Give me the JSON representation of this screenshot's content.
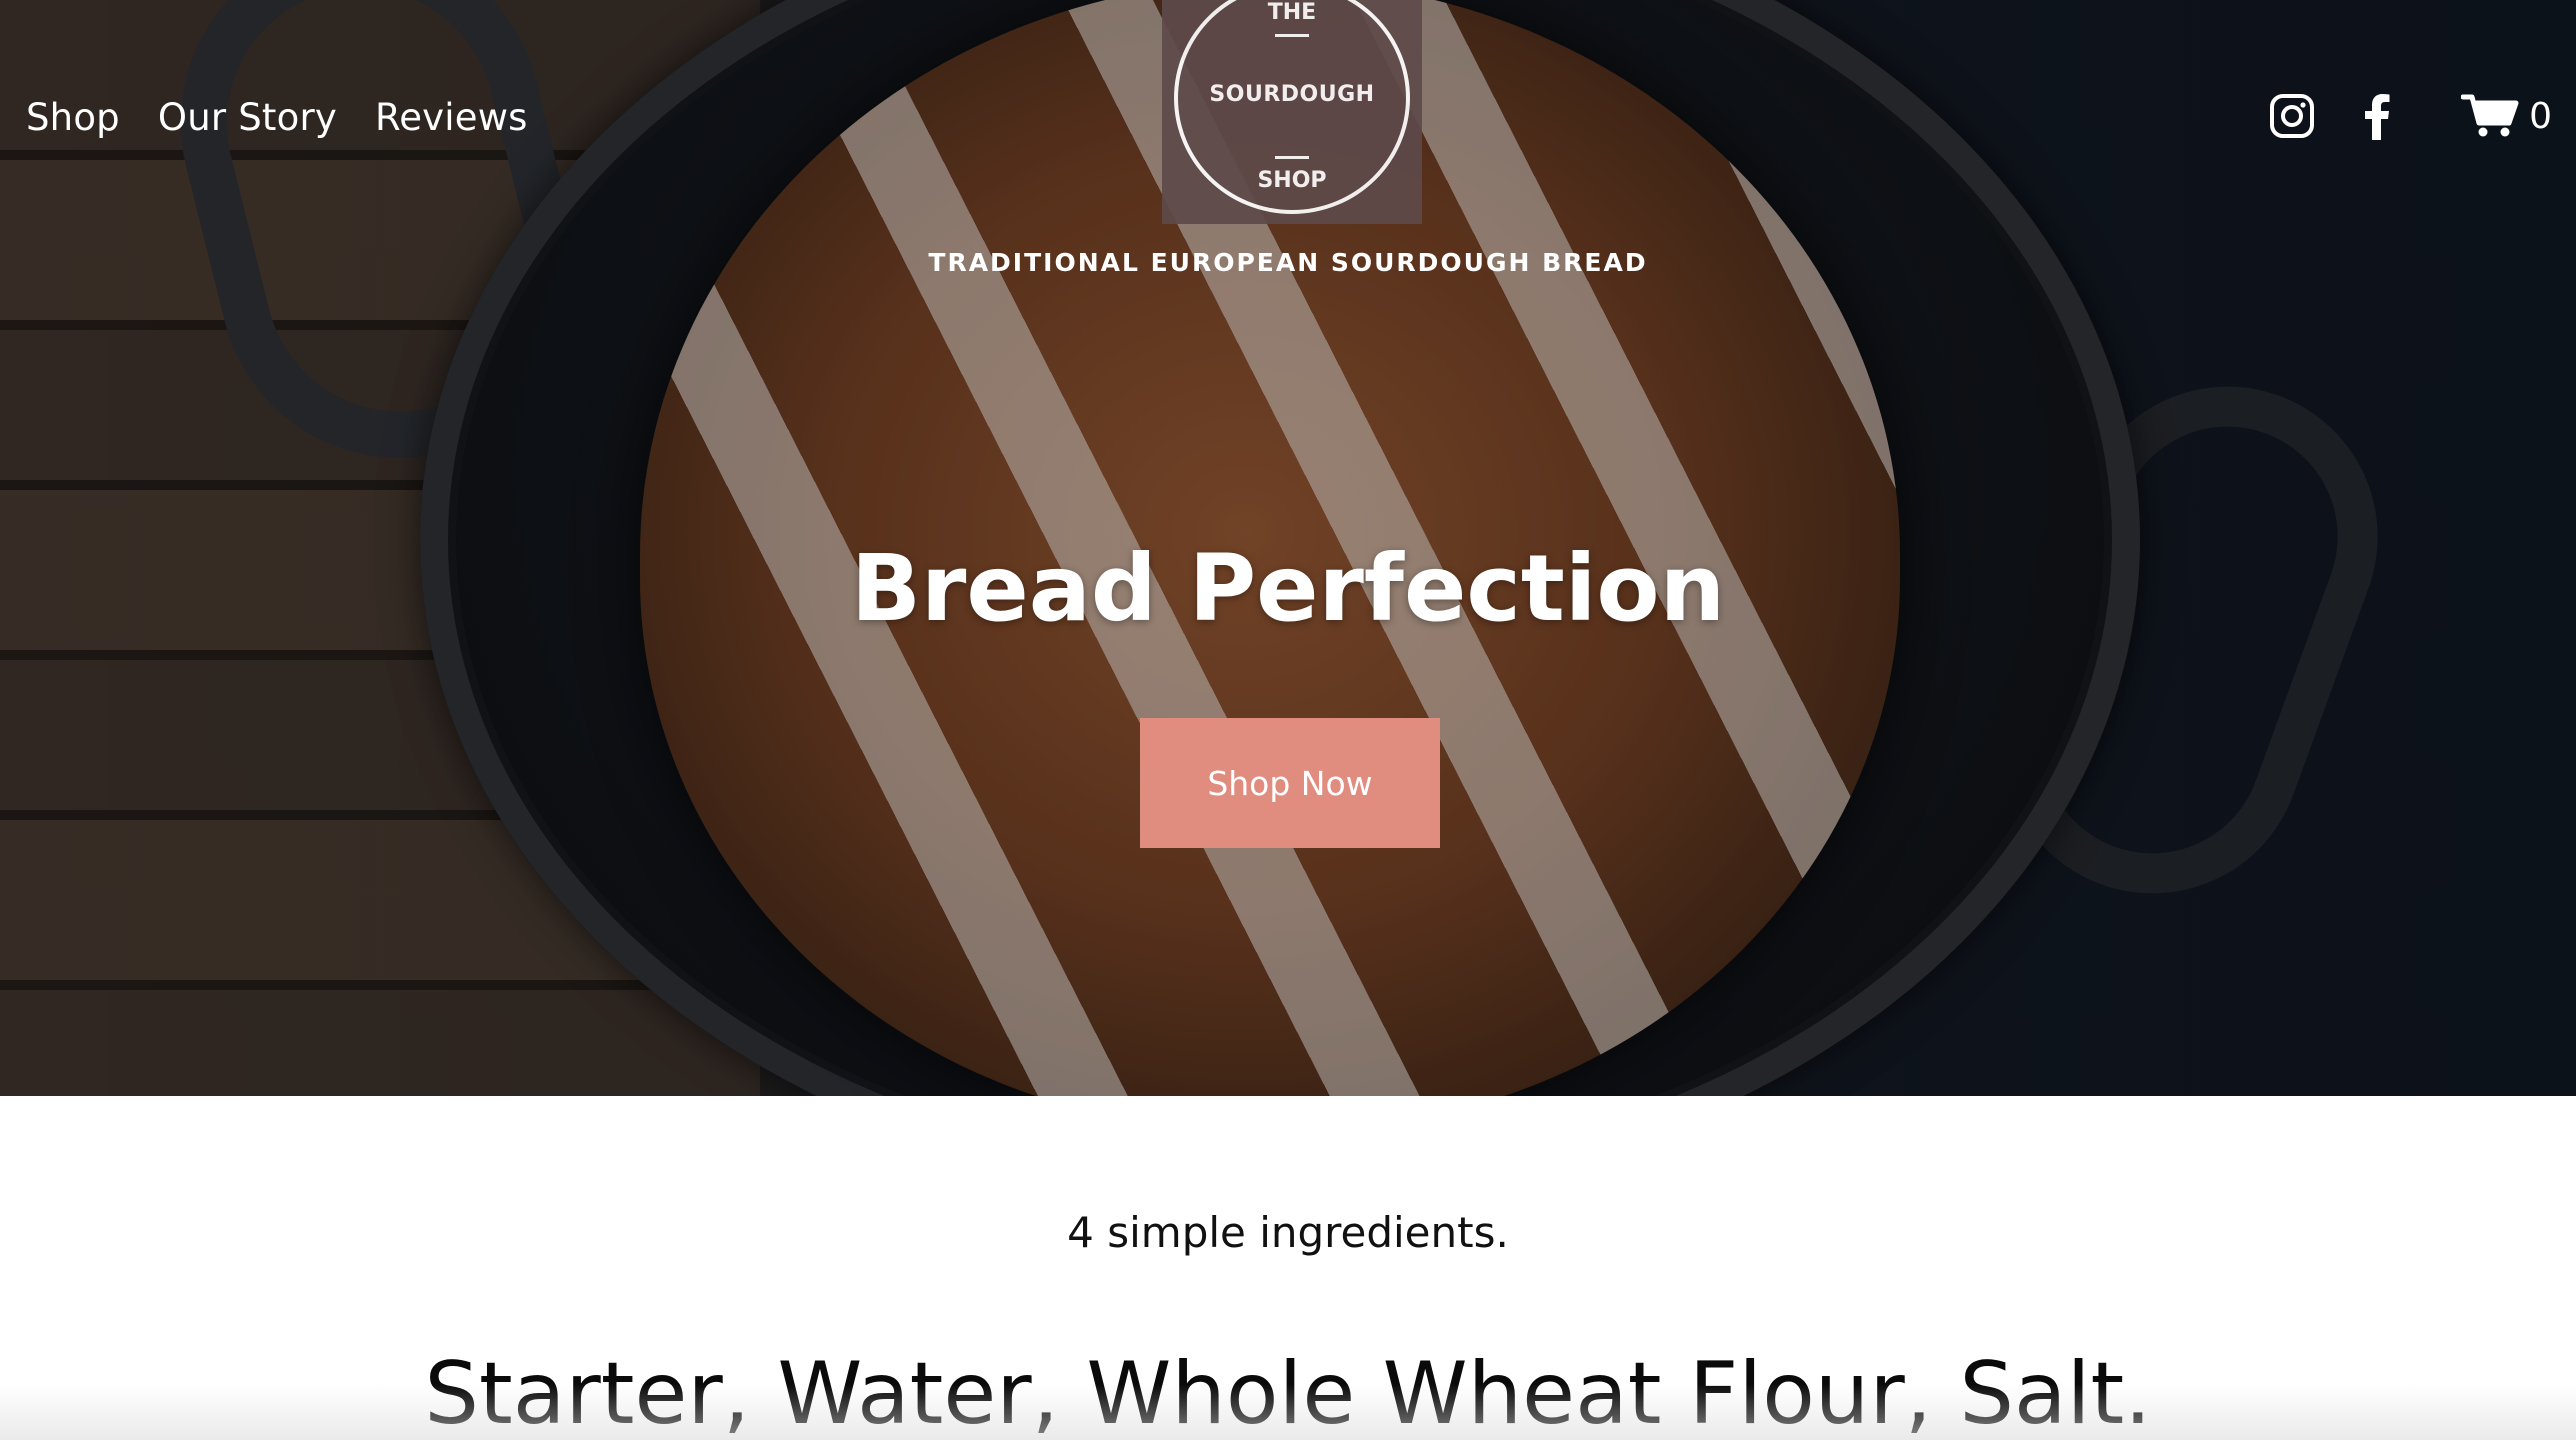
{
  "nav": {
    "links": [
      {
        "label": "Shop"
      },
      {
        "label": "Our Story"
      },
      {
        "label": "Reviews"
      }
    ]
  },
  "logo": {
    "line1": "THE",
    "line2": "SOURDOUGH",
    "line3": "SHOP"
  },
  "tagline": "TRADITIONAL EUROPEAN SOURDOUGH BREAD",
  "social": {
    "instagram_icon": "instagram-icon",
    "facebook_icon": "facebook-icon"
  },
  "cart": {
    "icon": "cart-icon",
    "count": "0"
  },
  "hero": {
    "title": "Bread Perfection",
    "cta_label": "Shop Now",
    "cta_color": "#e08d80"
  },
  "content": {
    "subhead": "4 simple ingredients.",
    "ingredients": "Starter, Water, Whole Wheat Flour, Salt."
  }
}
